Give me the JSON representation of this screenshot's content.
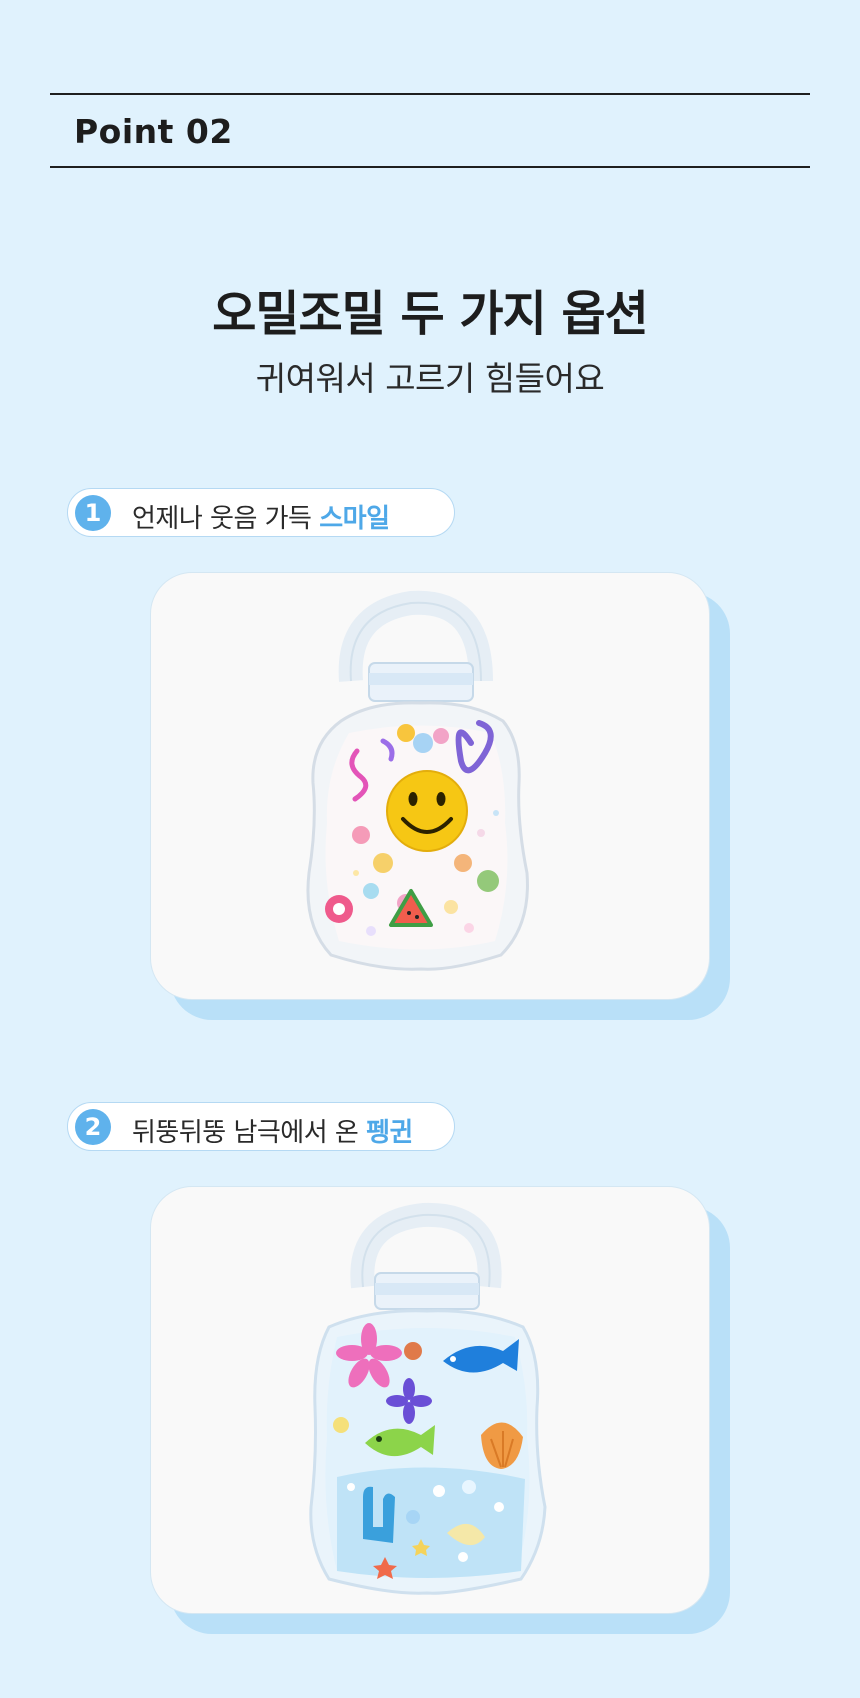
{
  "point": {
    "label": "Point  02"
  },
  "headline": "오밀조밀 두 가지 옵션",
  "subhead": "귀여워서 고르기 힘들어요",
  "options": [
    {
      "number": "1",
      "text": "언제나 웃음 가득 ",
      "highlight": "스마일",
      "image_name": "smile-hot-water-bag-image"
    },
    {
      "number": "2",
      "text": "뒤뚱뒤뚱 남극에서 온 ",
      "highlight": "펭귄",
      "image_name": "penguin-hot-water-bag-image"
    }
  ],
  "colors": {
    "background": "#e0f2fd",
    "accent": "#5fb2ec",
    "highlight_text": "#4ea8e8",
    "card_shadow": "#b9e0f8"
  }
}
